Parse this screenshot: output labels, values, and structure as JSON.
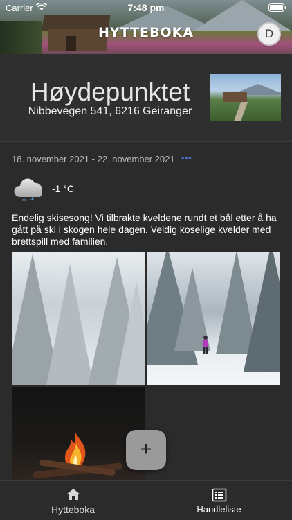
{
  "status": {
    "carrier": "Carrier",
    "time": "7:48 pm"
  },
  "header": {
    "title": "HYTTEBOKA",
    "avatar_initial": "D"
  },
  "cabin": {
    "name": "Høydepunktet",
    "address": "Nibbevegen 541, 6216 Geiranger"
  },
  "post": {
    "date_range": "18. november 2021 - 22. november 2021",
    "more_label": "•••",
    "weather": {
      "icon": "cloud-snow-icon",
      "temperature": "-1 °C"
    },
    "text": "Endelig skisesong! Vi tilbrakte kveldene rundt et bål etter å ha gått på ski i skogen hele dagen. Veldig koselige kvelder med brettspill med familien."
  },
  "fab": {
    "label": "+"
  },
  "tabbar": {
    "tabs": [
      {
        "label": "Hytteboka",
        "icon": "home-icon"
      },
      {
        "label": "Handleliste",
        "icon": "list-icon"
      }
    ]
  },
  "colors": {
    "background": "#2b2b2b",
    "accent": "#4a78d8",
    "fab": "#9a9a9a"
  }
}
